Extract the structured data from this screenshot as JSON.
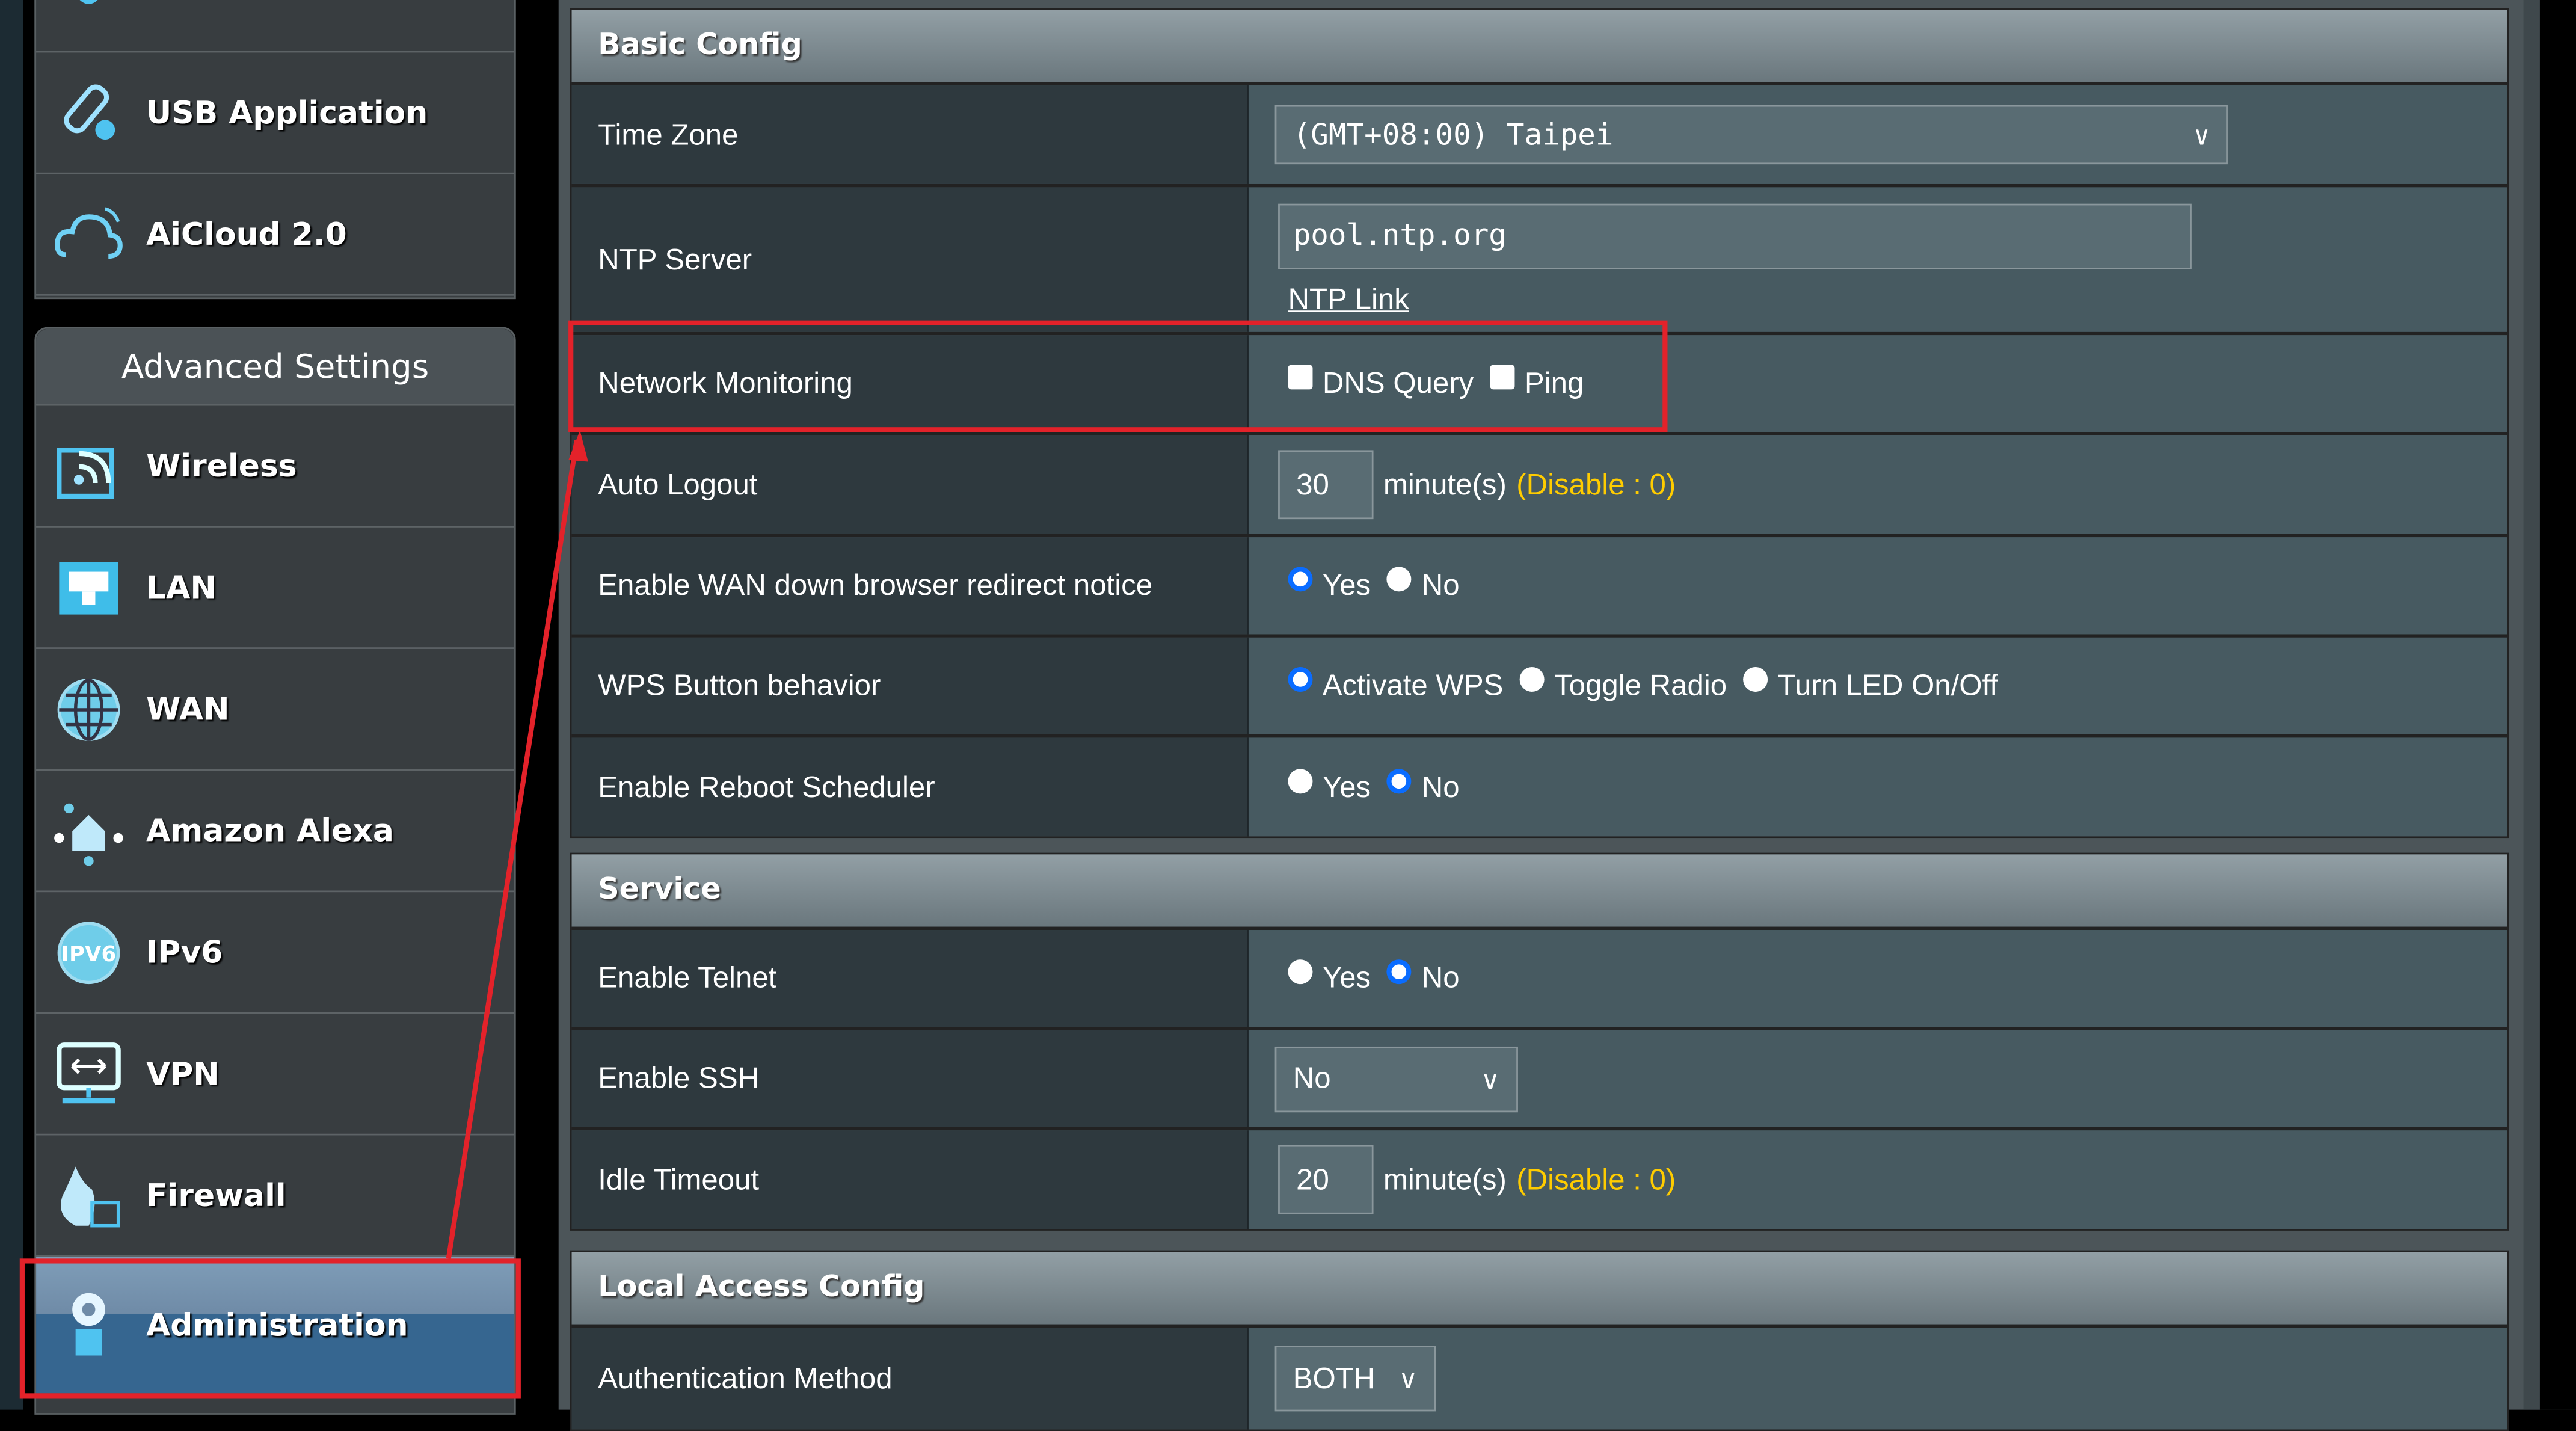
{
  "sidebar": {
    "top_items": [
      {
        "label": "",
        "icon": "network-map-icon"
      },
      {
        "label": "USB Application",
        "icon": "usb-icon"
      },
      {
        "label": "AiCloud 2.0",
        "icon": "cloud-icon"
      }
    ],
    "advanced_title": "Advanced Settings",
    "items": [
      {
        "label": "Wireless",
        "icon": "wireless-icon"
      },
      {
        "label": "LAN",
        "icon": "lan-icon"
      },
      {
        "label": "WAN",
        "icon": "globe-icon"
      },
      {
        "label": "Amazon Alexa",
        "icon": "alexa-icon"
      },
      {
        "label": "IPv6",
        "icon": "ipv6-icon"
      },
      {
        "label": "VPN",
        "icon": "vpn-icon"
      },
      {
        "label": "Firewall",
        "icon": "firewall-icon"
      },
      {
        "label": "Administration",
        "icon": "admin-gear-icon",
        "active": true
      }
    ]
  },
  "basic_config": {
    "title": "Basic Config",
    "time_zone": {
      "label": "Time Zone",
      "value": "(GMT+08:00) Taipei"
    },
    "ntp_server": {
      "label": "NTP Server",
      "value": "pool.ntp.org",
      "link": "NTP Link"
    },
    "network_monitoring": {
      "label": "Network Monitoring",
      "options": [
        {
          "label": "DNS Query",
          "checked": false
        },
        {
          "label": "Ping",
          "checked": false
        }
      ]
    },
    "auto_logout": {
      "label": "Auto Logout",
      "value": "30",
      "unit": "minute(s)",
      "hint": "(Disable : 0)"
    },
    "wan_redirect": {
      "label": "Enable WAN down browser redirect notice",
      "options": [
        {
          "label": "Yes",
          "selected": true
        },
        {
          "label": "No",
          "selected": false
        }
      ]
    },
    "wps_button": {
      "label": "WPS Button behavior",
      "options": [
        {
          "label": "Activate WPS",
          "selected": true
        },
        {
          "label": "Toggle Radio",
          "selected": false
        },
        {
          "label": "Turn LED On/Off",
          "selected": false
        }
      ]
    },
    "reboot_scheduler": {
      "label": "Enable Reboot Scheduler",
      "options": [
        {
          "label": "Yes",
          "selected": false
        },
        {
          "label": "No",
          "selected": true
        }
      ]
    }
  },
  "service": {
    "title": "Service",
    "telnet": {
      "label": "Enable Telnet",
      "options": [
        {
          "label": "Yes",
          "selected": false
        },
        {
          "label": "No",
          "selected": true
        }
      ]
    },
    "ssh": {
      "label": "Enable SSH",
      "value": "No"
    },
    "idle_timeout": {
      "label": "Idle Timeout",
      "value": "20",
      "unit": "minute(s)",
      "hint": "(Disable : 0)"
    }
  },
  "local_access": {
    "title": "Local Access Config",
    "auth_method": {
      "label": "Authentication Method",
      "value": "BOTH"
    }
  },
  "colors": {
    "annotation": "#e3222a",
    "accent_blue": "#0a6cff",
    "hint_yellow": "#ffcc00",
    "active_item": "#366690"
  }
}
